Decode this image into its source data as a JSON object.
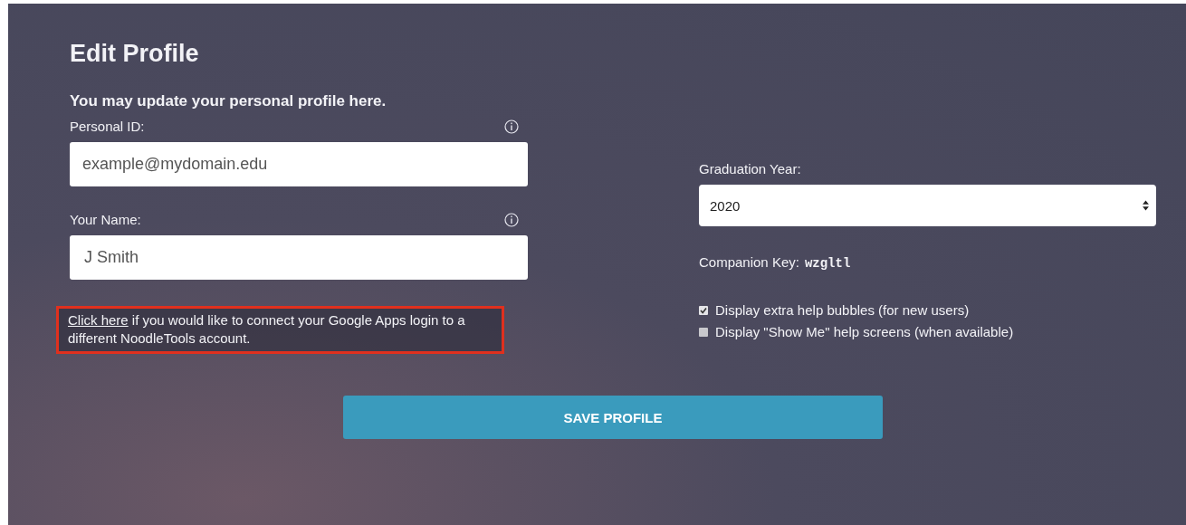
{
  "title": "Edit Profile",
  "subtitle": "You may update your personal profile here.",
  "left_fields": [
    {
      "label": "Personal ID:",
      "value": "example@mydomain.edu"
    },
    {
      "label": "Your Name:",
      "value": "J Smith"
    }
  ],
  "notice": {
    "link": "Click here",
    "text": " if you would like to connect your Google Apps login to a different NoodleTools account."
  },
  "graduation_year": {
    "label": "Graduation Year:",
    "value": "2020"
  },
  "companion_key": {
    "label": "Companion Key:",
    "value": "wzgltl"
  },
  "options": [
    {
      "label": "Display extra help bubbles (for new users)",
      "checked": true
    },
    {
      "label": "Display \"Show Me\" help screens (when available)",
      "checked": false
    }
  ],
  "save_button": "SAVE PROFILE"
}
